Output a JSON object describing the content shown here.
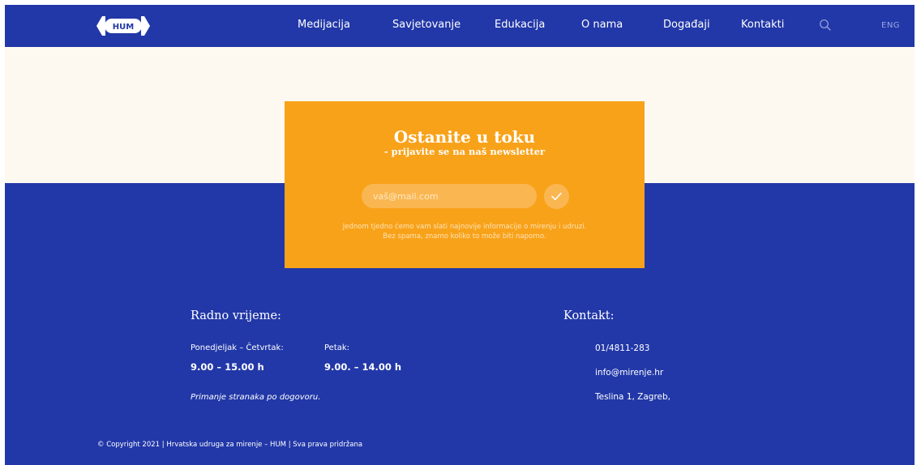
{
  "header": {
    "logo_text": "HUM",
    "nav": [
      {
        "label": "Medijacija"
      },
      {
        "label": "Savjetovanje"
      },
      {
        "label": "Edukacija"
      },
      {
        "label": "O nama"
      },
      {
        "label": "Događaji"
      },
      {
        "label": "Kontakti"
      }
    ],
    "search_icon": "search-icon",
    "lang_label": "ENG"
  },
  "newsletter": {
    "title": "Ostanite u toku",
    "subtitle": "- prijavite se na naš newsletter",
    "email_placeholder": "vaš@mail.com",
    "email_value": "",
    "submit_icon": "check-icon",
    "note_line1": "Jednom tjedno ćemo vam slati najnovije informacije o mirenju i udruzi.",
    "note_line2": "Bez spama, znamo koliko to može biti naporno."
  },
  "hours": {
    "heading": "Radno vrijeme:",
    "weekday_label": "Ponedjeljak – Četvrtak:",
    "weekday_hours": "9.00 – 15.00 h",
    "friday_label": "Petak:",
    "friday_hours": "9.00. – 14.00 h",
    "note": "Primanje stranaka po dogovoru."
  },
  "contact": {
    "heading": "Kontakt:",
    "phone": "01/4811-283",
    "email": "info@mirenje.hr",
    "address": "Teslina 1, Zagreb,"
  },
  "footer": {
    "copyright": "© Copyright 2021 | Hrvatska udruga za mirenje – HUM | Sva prava pridržana"
  },
  "colors": {
    "brand_blue": "#2238a8",
    "accent_orange": "#f8a21a",
    "cream": "#fdf9f1"
  }
}
